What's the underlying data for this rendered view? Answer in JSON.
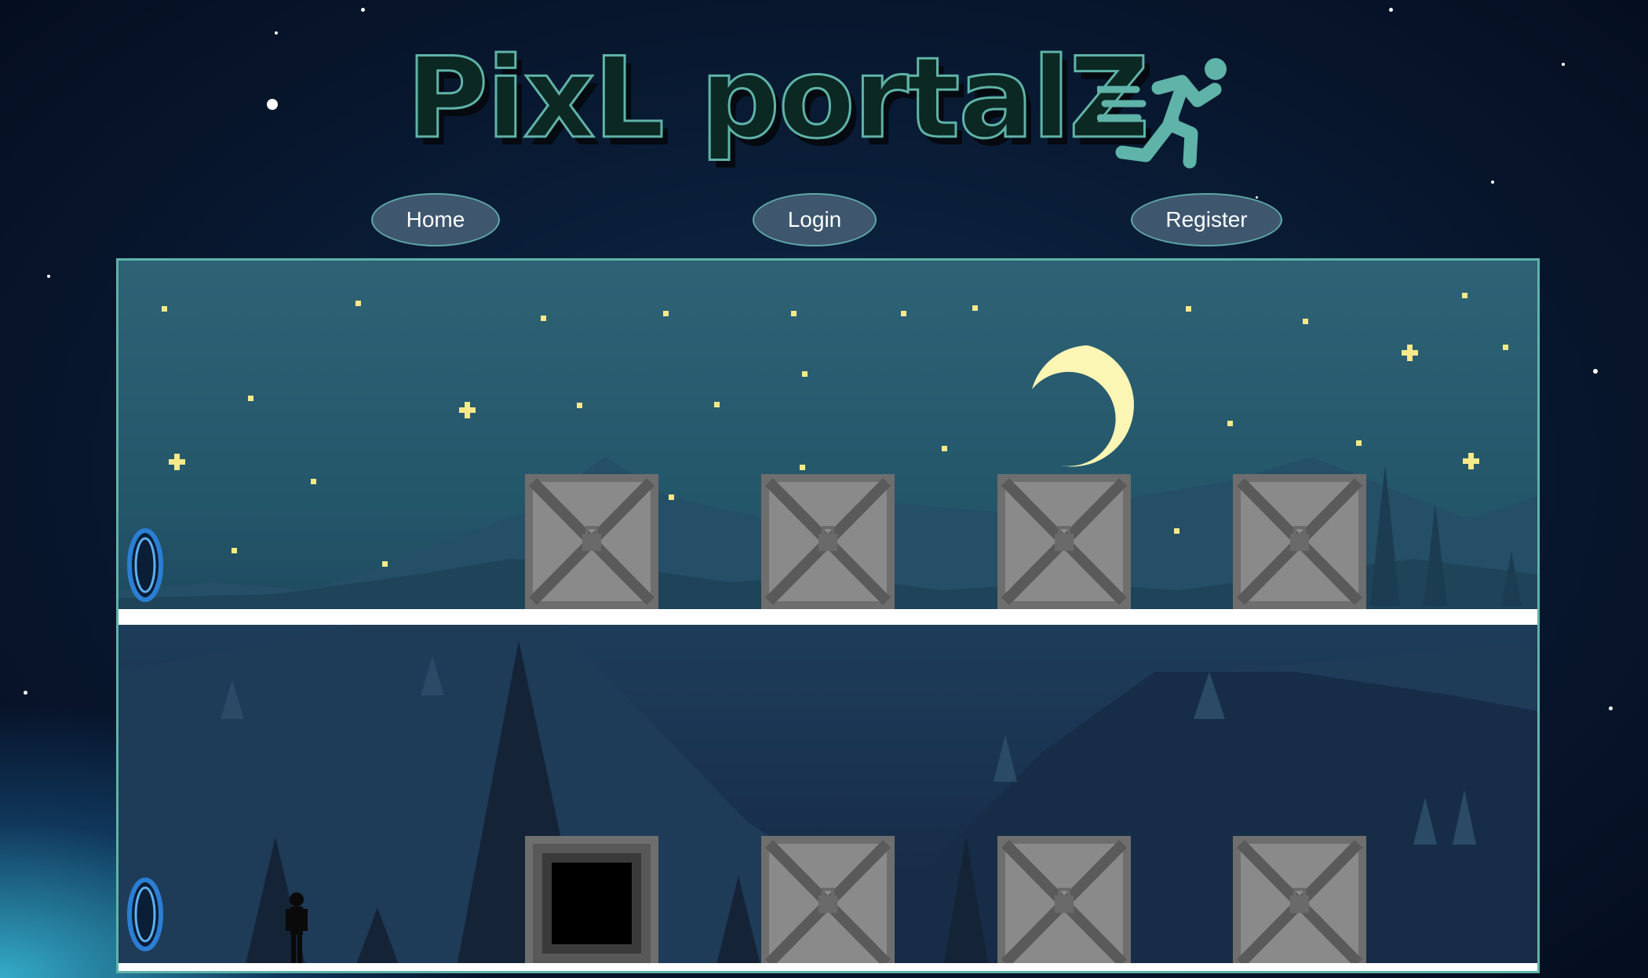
{
  "header": {
    "title": "PixL portalZ",
    "logo_icon": "running-person-icon",
    "accent_color": "#5fb3a8"
  },
  "nav": {
    "home": "Home",
    "login": "Login",
    "register": "Register"
  },
  "game": {
    "levels": [
      {
        "name": "level-1",
        "items": [
          "portal-icon",
          "crate-icon",
          "crate-icon",
          "crate-icon",
          "crate-icon",
          "moon-icon"
        ]
      },
      {
        "name": "level-2",
        "items": [
          "portal-icon",
          "player-icon",
          "dark-exit-block-icon",
          "crate-icon",
          "crate-icon",
          "crate-icon"
        ]
      }
    ],
    "colors": {
      "sky_top": "#2e6275",
      "sky_bottom": "#142640",
      "moon": "#fbf6b4",
      "crate": "#808080",
      "portal": "#2a7fd4",
      "ground": "#ffffff"
    }
  }
}
